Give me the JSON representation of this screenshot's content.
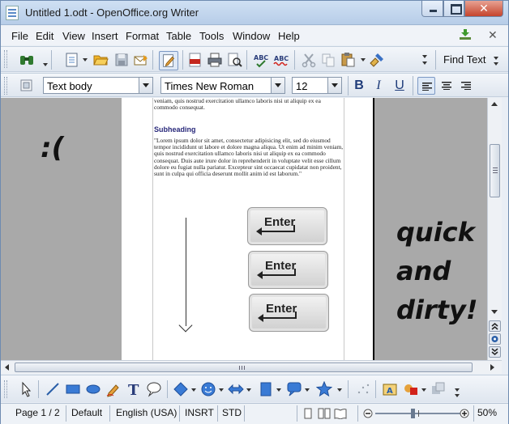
{
  "window": {
    "title": "Untitled 1.odt - OpenOffice.org Writer",
    "close_glyph": "✕"
  },
  "menu": {
    "items": [
      "File",
      "Edit",
      "View",
      "Insert",
      "Format",
      "Table",
      "Tools",
      "Window",
      "Help"
    ],
    "close_glyph": "✕"
  },
  "toolbar": {
    "find_text_label": "Find Text",
    "icons": [
      "binoculars-icon",
      "new-document-icon",
      "open-folder-icon",
      "save-icon",
      "email-icon",
      "edit-mode-icon",
      "export-pdf-icon",
      "print-icon",
      "page-preview-icon",
      "spellcheck-icon",
      "autospellcheck-icon",
      "cut-icon",
      "copy-icon",
      "paste-icon",
      "format-paintbrush-icon"
    ]
  },
  "formatting": {
    "style": "Text body",
    "font": "Times New Roman",
    "size": "12",
    "bold": "B",
    "italic": "I",
    "underline": "U"
  },
  "document": {
    "top_text": "veniam, quis nostrud exercitation ullamco laboris nisi ut aliquip ex ea commodo consequat.",
    "subheading": "Subheading",
    "body_text": "\"Lorem ipsum dolor sit amet, consectetur adipisicing elit, sed do eiusmod tempor incididunt ut labore et dolore magna aliqua. Ut enim ad minim veniam, quis nostrud exercitation ullamco laboris nisi ut aliquip ex ea commodo consequat. Duis aute irure dolor in reprehenderit in voluptate velit esse cillum dolore eu fugiat nulla pariatur. Excepteur sint occaecat cupidatat non proident, sunt in culpa qui officia deserunt mollit anim id est laborum.\"",
    "enter_keys": [
      "Enter",
      "Enter",
      "Enter"
    ]
  },
  "annotations": {
    "sad_face": ":(",
    "quick_dirty": [
      "quick",
      "and",
      "dirty!"
    ]
  },
  "status": {
    "page": "Page 1 / 2",
    "page_style": "Default",
    "language": "English (USA)",
    "insert_mode": "INSRT",
    "selection_mode": "STD",
    "zoom": "50%"
  }
}
